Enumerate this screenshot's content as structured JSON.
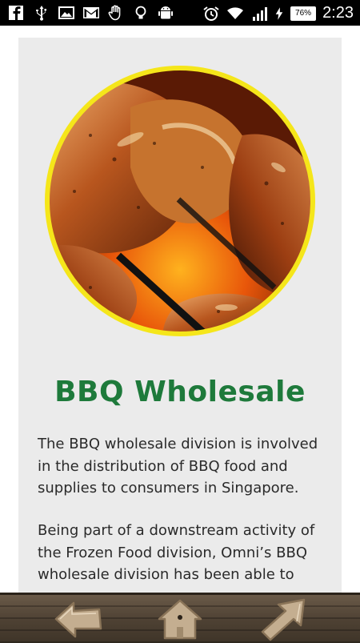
{
  "status_bar": {
    "left_icons": [
      "facebook-icon",
      "usb-icon",
      "image-icon",
      "gmail-icon",
      "hand-icon",
      "lightbulb-icon",
      "android-icon"
    ],
    "right_icons": [
      "alarm-icon",
      "wifi-icon",
      "signal-icon",
      "charging-icon"
    ],
    "battery": "76%",
    "time": "2:23"
  },
  "content": {
    "image_icon": "bbq-chicken-photo",
    "title": "BBQ Wholesale",
    "paragraph_1": "The BBQ wholesale division is involved in the distribution of BBQ food and supplies to consumers in Singapore.",
    "paragraph_2": "Being part of a downstream activity of the Frozen Food division, Omni’s BBQ wholesale division has been able to"
  },
  "bottom_nav": {
    "back_icon": "arrow-back-icon",
    "home_icon": "home-icon",
    "forward_icon": "arrow-forward-icon"
  },
  "colors": {
    "title_green": "#1e7a3b",
    "card_bg": "#ebebeb",
    "photo_ring": "#f5e61a"
  }
}
